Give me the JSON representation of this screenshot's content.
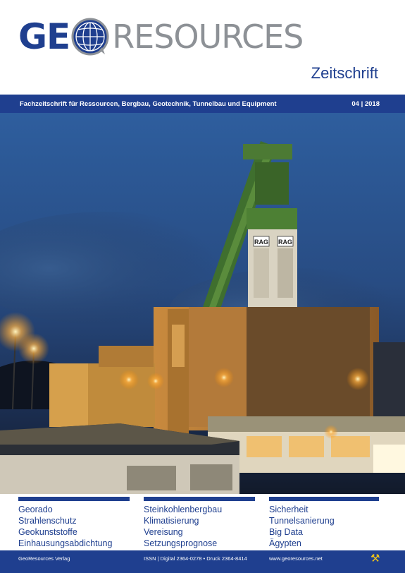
{
  "logo": {
    "part1": "GE",
    "part2": "RESOURCES"
  },
  "subtitle": "Zeitschrift",
  "banner": {
    "tagline": "Fachzeitschrift für Ressourcen, Bergbau, Geotechnik, Tunnelbau und Equipment",
    "issue": "04 | 2018"
  },
  "photo": {
    "signs": [
      "RAG",
      "RAG"
    ]
  },
  "topics": {
    "col1": [
      "Georado",
      "Strahlenschutz",
      "Geokunststoffe",
      "Einhausungsabdichtung"
    ],
    "col2": [
      "Steinkohlenbergbau",
      "Klimatisierung",
      "Vereisung",
      "Setzungsprognose"
    ],
    "col3": [
      "Sicherheit",
      "Tunnelsanierung",
      "Big Data",
      "Ägypten"
    ]
  },
  "footer": {
    "publisher": "GeoResources Verlag",
    "issn": "ISSN | Digital 2364-0278 • Druck 2364-8414",
    "website": "www.georesources.net",
    "icon": "hammer-pick-icon"
  },
  "colors": {
    "brand_blue": "#1f3f8f",
    "logo_gray": "#8d9196"
  }
}
